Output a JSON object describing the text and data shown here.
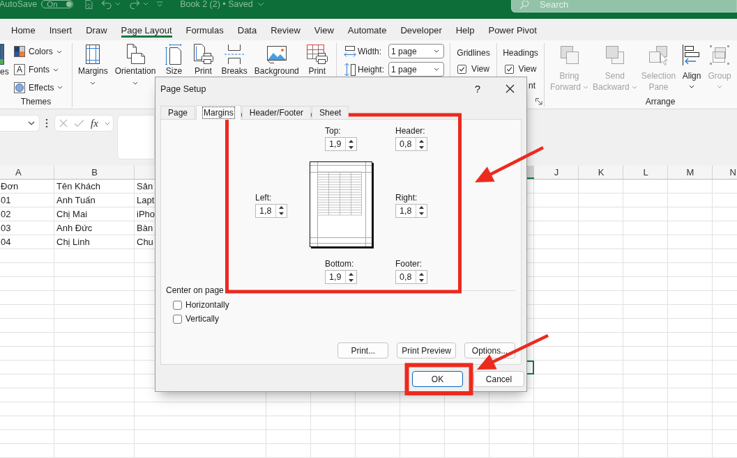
{
  "title_bar": {
    "autosave": {
      "label": "AutoSave",
      "state_label": "On",
      "on": true
    },
    "document_title": "Book 2 (2) • Saved",
    "search": {
      "placeholder": "Search"
    }
  },
  "ribbon_tabs": [
    {
      "label": "Home",
      "selected": false
    },
    {
      "label": "Insert",
      "selected": false
    },
    {
      "label": "Draw",
      "selected": false
    },
    {
      "label": "Page Layout",
      "selected": true
    },
    {
      "label": "Formulas",
      "selected": false
    },
    {
      "label": "Data",
      "selected": false
    },
    {
      "label": "Review",
      "selected": false
    },
    {
      "label": "View",
      "selected": false
    },
    {
      "label": "Automate",
      "selected": false
    },
    {
      "label": "Developer",
      "selected": false
    },
    {
      "label": "Help",
      "selected": false
    },
    {
      "label": "Power Pivot",
      "selected": false
    }
  ],
  "ribbon": {
    "themes": {
      "label": "Themes",
      "themes_button": "es",
      "items": [
        {
          "kind": "colors",
          "label": "Colors"
        },
        {
          "kind": "fonts",
          "label": "Fonts",
          "icon_text": "A"
        },
        {
          "kind": "effects",
          "label": "Effects"
        }
      ]
    },
    "page_setup": {
      "buttons": [
        {
          "kind": "margins",
          "label": "Margins",
          "dropdown": true
        },
        {
          "kind": "orientation",
          "label": "Orientation",
          "dropdown": true
        },
        {
          "kind": "size",
          "label": "Size"
        },
        {
          "kind": "print-area",
          "label": "Print"
        },
        {
          "kind": "breaks",
          "label": "Breaks"
        },
        {
          "kind": "background",
          "label": "Background"
        },
        {
          "kind": "print-titles",
          "label": "Print"
        }
      ]
    },
    "scale_to_fit": {
      "rows": [
        {
          "kind": "width",
          "label": "Width:",
          "value": "1 page"
        },
        {
          "kind": "height",
          "label": "Height:",
          "value": "1 page"
        }
      ]
    },
    "sheet_options": {
      "columns": [
        {
          "title": "Gridlines",
          "view": {
            "label": "View",
            "checked": true
          }
        },
        {
          "title": "Headings",
          "view": {
            "label": "View",
            "checked": true
          },
          "partial_label": "nt"
        }
      ]
    },
    "arrange": {
      "label": "Arrange",
      "buttons": [
        {
          "kind": "bring-forward",
          "lines": [
            "Bring",
            "Forward"
          ],
          "dropdown": true,
          "disabled": true
        },
        {
          "kind": "send-backward",
          "lines": [
            "Send",
            "Backward"
          ],
          "dropdown": true,
          "disabled": true
        },
        {
          "kind": "selection-pane",
          "lines": [
            "Selection",
            "Pane"
          ],
          "disabled": true
        },
        {
          "kind": "align",
          "lines": [
            "Align"
          ],
          "dropdown": true,
          "disabled": false
        },
        {
          "kind": "group",
          "lines": [
            "Group"
          ],
          "dropdown": true,
          "disabled": true
        }
      ]
    }
  },
  "formula_bar": {
    "function_label": "fx"
  },
  "sheet": {
    "column_headers_left": [
      "A",
      "B"
    ],
    "column_headers_right": [
      "J",
      "K",
      "L",
      "M",
      "N"
    ],
    "rows": [
      [
        "Đơn",
        "Tên Khách",
        "Sản"
      ],
      [
        "01",
        "Anh Tuấn",
        "Lapt"
      ],
      [
        "02",
        "Chị Mai",
        "iPho"
      ],
      [
        "03",
        "Anh Đức",
        "Bàn"
      ],
      [
        "04",
        "Chị Linh",
        "Chu"
      ]
    ],
    "active_cell_highlight": true
  },
  "page_setup_dialog": {
    "title": "Page Setup",
    "help": "?",
    "tabs": [
      {
        "label": "Page",
        "selected": false
      },
      {
        "label": "Margins",
        "selected": true
      },
      {
        "label": "Header/Footer",
        "selected": false
      },
      {
        "label": "Sheet",
        "selected": false
      }
    ],
    "margins": [
      {
        "kind": "top",
        "label": "Top:",
        "value": "1,9"
      },
      {
        "kind": "header",
        "label": "Header:",
        "value": "0,8"
      },
      {
        "kind": "left",
        "label": "Left:",
        "value": "1,8"
      },
      {
        "kind": "right",
        "label": "Right:",
        "value": "1,8"
      },
      {
        "kind": "bottom",
        "label": "Bottom:",
        "value": "1,9"
      },
      {
        "kind": "footer",
        "label": "Footer:",
        "value": "0,8"
      }
    ],
    "center_on_page": {
      "title": "Center on page",
      "options": [
        {
          "label": "Horizontally",
          "checked": false
        },
        {
          "label": "Vertically",
          "checked": false
        }
      ]
    },
    "panel_buttons": [
      "Print...",
      "Print Preview",
      "Options..."
    ],
    "buttons": [
      {
        "label": "OK",
        "focused": true
      },
      {
        "label": "Cancel",
        "focused": false
      }
    ]
  },
  "annotations": [
    {
      "kind": "rectangle"
    },
    {
      "kind": "arrow"
    },
    {
      "kind": "rectangle"
    },
    {
      "kind": "arrow"
    }
  ]
}
